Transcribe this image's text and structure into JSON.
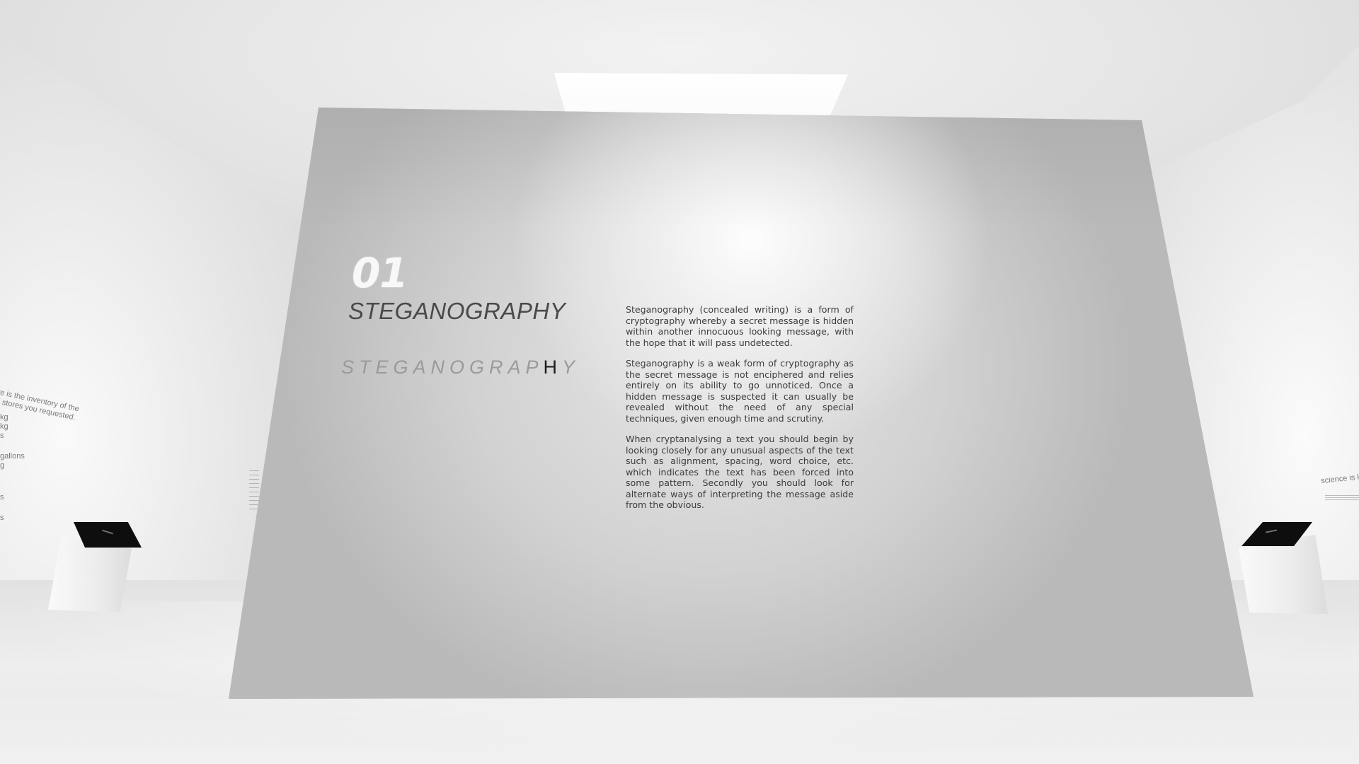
{
  "exhibit": {
    "number": "01",
    "title": "STEGANOGRAPHY",
    "spaced_word_dim": "STEGANOGRAP",
    "spaced_word_highlight": "H",
    "spaced_word_tail": "Y",
    "paragraphs": [
      "Steganography (concealed writing) is a form of cryptography whereby a secret message is hidden within another innocuous looking message, with the hope that it will pass undetected.",
      "Steganography is a weak form of cryptography as the secret message is not enciphered and relies entirely on its ability to go unnoticed. Once a hidden message is suspected it can usually be revealed without the need of any special techniques, given enough time and scrutiny.",
      "When cryptanalysing a text you should begin by looking closely for any unusual aspects of the text such as alignment, spacing, word choice, etc. which indicates the text has been forced into some pattern. Secondly you should look for alternate ways of interpreting the message aside from the obvious."
    ]
  },
  "side_panels": {
    "left_intro": "ere is the inventory of the ed stores you requested.",
    "left_list": [
      "kg",
      "kg",
      "s",
      "gallons",
      "g",
      "",
      "s",
      "s"
    ],
    "right_text": "science is k"
  },
  "colors": {
    "panel": "#c4c4c4",
    "title": "#4a4a4a",
    "number": "#f8f8f8",
    "spaced_dim": "#9a9a9a",
    "spaced_highlight": "#1e1e1e",
    "body": "#3c3c3c"
  }
}
